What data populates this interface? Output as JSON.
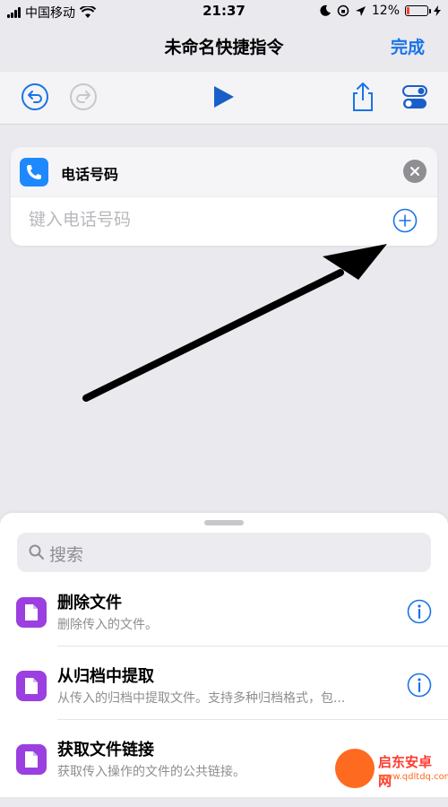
{
  "status_bar": {
    "carrier": "中国移动",
    "time": "21:37",
    "battery": "12%",
    "battery_level": 0.12
  },
  "nav": {
    "title": "未命名快捷指令",
    "done_label": "完成"
  },
  "toolbar": {
    "icons": [
      "undo-icon",
      "redo-icon",
      "play-icon",
      "share-icon",
      "settings-toggle-icon"
    ]
  },
  "action_card": {
    "title": "电话号码",
    "input_placeholder": "键入电话号码",
    "icon": "phone-icon"
  },
  "sheet": {
    "search_placeholder": "搜索",
    "actions": [
      {
        "title": "删除文件",
        "subtitle": "删除传入的文件。"
      },
      {
        "title": "从归档中提取",
        "subtitle": "从传入的归档中提取文件。支持多种归档格式，包..."
      },
      {
        "title": "获取文件链接",
        "subtitle": "获取传入操作的文件的公共链接。"
      }
    ]
  },
  "watermark": {
    "text": "启东安卓网",
    "url": "www.qdltdq.com"
  },
  "colors": {
    "accent": "#1a73e8",
    "phone_badge": "#1e88ff",
    "file_icon": "#9b3fe0",
    "background": "#e9e9ee"
  }
}
